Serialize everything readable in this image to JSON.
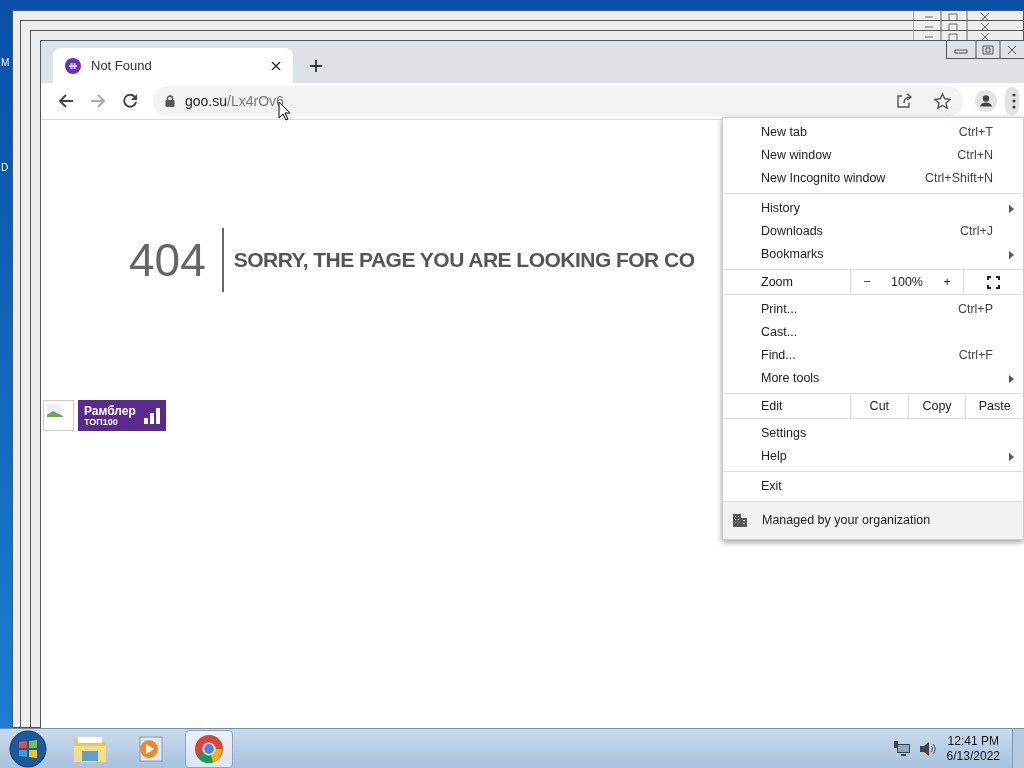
{
  "desktop": {
    "icon_labels": [
      "M",
      "D"
    ]
  },
  "browser": {
    "tab": {
      "title": "Not Found"
    },
    "address": {
      "host": "goo.su",
      "path": "/Lx4rOv6"
    }
  },
  "page": {
    "code": "404",
    "message": "SORRY, THE PAGE YOU ARE LOOKING FOR CO",
    "badge": {
      "title": "Рамблер",
      "subtitle": "ТОП100"
    }
  },
  "menu": {
    "sections": [
      [
        {
          "kind": "item",
          "label": "New tab",
          "shortcut": "Ctrl+T",
          "submenu": false
        },
        {
          "kind": "item",
          "label": "New window",
          "shortcut": "Ctrl+N",
          "submenu": false
        },
        {
          "kind": "item",
          "label": "New Incognito window",
          "shortcut": "Ctrl+Shift+N",
          "submenu": false
        }
      ],
      [
        {
          "kind": "item",
          "label": "History",
          "submenu": true
        },
        {
          "kind": "item",
          "label": "Downloads",
          "shortcut": "Ctrl+J",
          "submenu": false
        },
        {
          "kind": "item",
          "label": "Bookmarks",
          "submenu": true
        }
      ],
      [
        {
          "kind": "zoom",
          "label": "Zoom",
          "minus": "−",
          "value": "100%",
          "plus": "+"
        }
      ],
      [
        {
          "kind": "item",
          "label": "Print...",
          "shortcut": "Ctrl+P",
          "submenu": false
        },
        {
          "kind": "item",
          "label": "Cast...",
          "submenu": false
        },
        {
          "kind": "item",
          "label": "Find...",
          "shortcut": "Ctrl+F",
          "submenu": false
        },
        {
          "kind": "item",
          "label": "More tools",
          "submenu": true
        }
      ],
      [
        {
          "kind": "edit",
          "label": "Edit",
          "buttons": [
            "Cut",
            "Copy",
            "Paste"
          ]
        }
      ],
      [
        {
          "kind": "item",
          "label": "Settings",
          "submenu": false
        },
        {
          "kind": "item",
          "label": "Help",
          "submenu": true
        }
      ],
      [
        {
          "kind": "item",
          "label": "Exit",
          "submenu": false
        }
      ]
    ],
    "footer": "Managed by your organization"
  },
  "taskbar": {
    "time": "12:41 PM",
    "date": "6/13/2022"
  }
}
